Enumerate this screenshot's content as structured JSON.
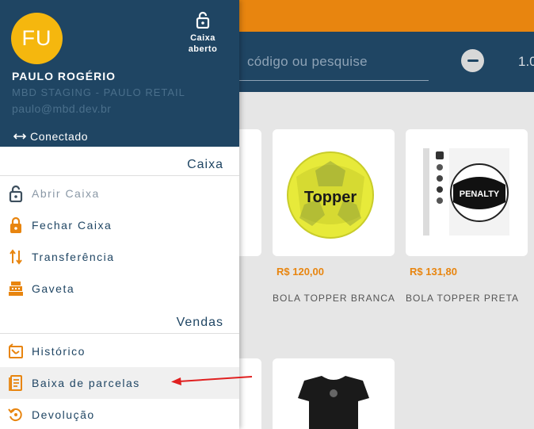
{
  "header": {
    "search_placeholder": "código ou pesquise",
    "quantity": "1.0"
  },
  "products": [
    {
      "name": "BOLA TOPPER BRANCA",
      "price": "R$ 120,00",
      "brand_print": "Topper"
    },
    {
      "name": "BOLA TOPPER PRETA",
      "price": "R$ 131,80",
      "brand_print": "PENALTY"
    }
  ],
  "drawer": {
    "avatar_initials": "FU",
    "cash_status": {
      "line1": "Caixa",
      "line2": "aberto"
    },
    "user": {
      "name": "PAULO ROGÉRIO",
      "org": "MBD STAGING - PAULO RETAIL",
      "email": "paulo@mbd.dev.br"
    },
    "connection": "Conectado",
    "sections": [
      {
        "title": "Caixa",
        "items": [
          {
            "label": "Abrir Caixa",
            "icon": "lock-open-icon",
            "disabled": true
          },
          {
            "label": "Fechar Caixa",
            "icon": "lock-icon"
          },
          {
            "label": "Transferência",
            "icon": "transfer-icon"
          },
          {
            "label": "Gaveta",
            "icon": "cash-register-icon"
          }
        ]
      },
      {
        "title": "Vendas",
        "items": [
          {
            "label": "Histórico",
            "icon": "history-icon"
          },
          {
            "label": "Baixa de parcelas",
            "icon": "receipt-icon",
            "active": true
          },
          {
            "label": "Devolução",
            "icon": "return-icon"
          }
        ]
      }
    ]
  },
  "colors": {
    "primary": "#1f4563",
    "accent": "#e8850f",
    "avatar": "#f5b70e",
    "annotation": "#e02020"
  }
}
